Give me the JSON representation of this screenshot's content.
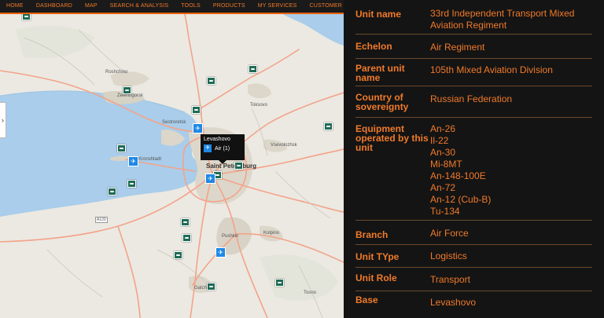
{
  "nav": {
    "items": [
      "HOME",
      "DASHBOARD",
      "MAP",
      "SEARCH & ANALYSIS",
      "TOOLS",
      "PRODUCTS",
      "MY SERVICES",
      "CUSTOMER CARE"
    ]
  },
  "map": {
    "labels": {
      "roshchino": "Roshchino",
      "zelenogorsk": "Zelenogorsk",
      "sestroretsk": "Sestroretsk",
      "toksovo": "Toksovo",
      "vsevolozhsk": "Vsevolozhsk",
      "kronshtadt": "Kronshtadt",
      "saint_petersburg": "Saint Petersburg",
      "pushkin": "Pushkin",
      "kolpino": "Kolpino",
      "gatchina": "Gatchina",
      "tosno": "Tosno",
      "road_a120": "A120"
    },
    "popup": {
      "title": "Levashovo",
      "item": "Air (1)"
    },
    "side_tab_icon": "chevron-right-icon"
  },
  "details": {
    "unit_name": {
      "label": "Unit name",
      "value": "33rd Independent Transport Mixed Aviation Regiment"
    },
    "echelon": {
      "label": "Echelon",
      "value": "Air Regiment"
    },
    "parent_unit": {
      "label": "Parent unit name",
      "value": "105th Mixed Aviation Division"
    },
    "country": {
      "label": "Country of sovereignty",
      "value": "Russian Federation"
    },
    "equipment": {
      "label": "Equipment operated by this unit",
      "values": [
        "An-26",
        "Il-22",
        "An-30",
        "Mi-8MT",
        "An-148-100E",
        "An-72",
        "An-12 (Cub-B)",
        "Tu-134"
      ]
    },
    "branch": {
      "label": "Branch",
      "value": "Air Force"
    },
    "unit_type": {
      "label": "Unit TYpe",
      "value": "Logistics"
    },
    "unit_role": {
      "label": "Unit Role",
      "value": "Transport"
    },
    "base": {
      "label": "Base",
      "value": "Levashovo"
    }
  },
  "colors": {
    "accent": "#f07a2a",
    "water": "#a9cdea",
    "marker": "#1f6b55",
    "air_marker": "#1e88e5"
  }
}
